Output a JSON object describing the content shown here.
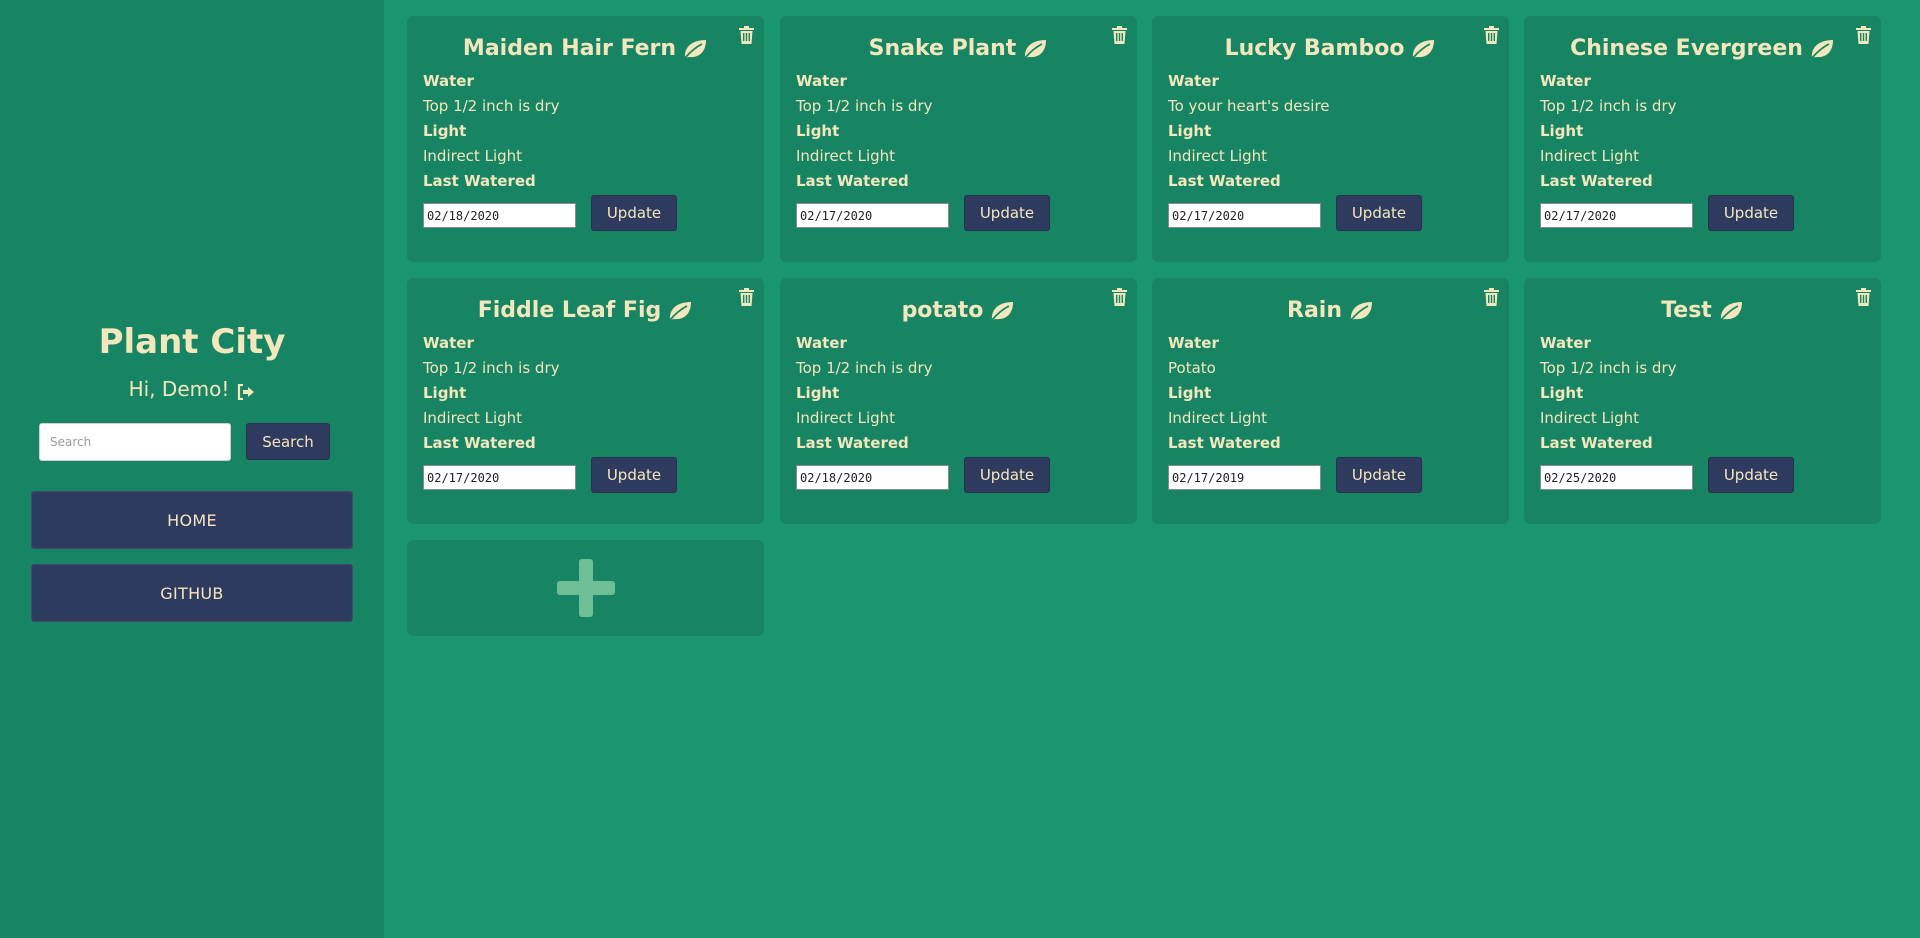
{
  "sidebar": {
    "title": "Plant City",
    "greeting": "Hi, Demo!",
    "logout_icon": "sign-out-icon",
    "search": {
      "placeholder": "Search",
      "value": "",
      "button_label": "Search"
    },
    "nav": [
      {
        "label": "HOME"
      },
      {
        "label": "GITHUB"
      }
    ]
  },
  "field_labels": {
    "water": "Water",
    "light": "Light",
    "last_watered": "Last Watered"
  },
  "update_label": "Update",
  "icons": {
    "title": "leaf-icon",
    "delete": "trash-icon",
    "add": "plus-icon"
  },
  "colors": {
    "background": "#1a966f",
    "sidebar": "#178563",
    "card": "#178563",
    "text": "#f3e7bd",
    "button": "#2e3a5e",
    "add_icon": "#6fbf96"
  },
  "plants": [
    {
      "name": "Maiden Hair Fern",
      "water": "Top 1/2 inch is dry",
      "light": "Indirect Light",
      "last_watered": "02/18/2020"
    },
    {
      "name": "Snake Plant",
      "water": "Top 1/2 inch is dry",
      "light": "Indirect Light",
      "last_watered": "02/17/2020"
    },
    {
      "name": "Lucky Bamboo",
      "water": "To your heart's desire",
      "light": "Indirect Light",
      "last_watered": "02/17/2020"
    },
    {
      "name": "Chinese Evergreen",
      "water": "Top 1/2 inch is dry",
      "light": "Indirect Light",
      "last_watered": "02/17/2020"
    },
    {
      "name": "Fiddle Leaf Fig",
      "water": "Top 1/2 inch is dry",
      "light": "Indirect Light",
      "last_watered": "02/17/2020"
    },
    {
      "name": "potato",
      "water": "Top 1/2 inch is dry",
      "light": "Indirect Light",
      "last_watered": "02/18/2020"
    },
    {
      "name": "Rain",
      "water": "Potato",
      "light": "Indirect Light",
      "last_watered": "02/17/2019"
    },
    {
      "name": "Test",
      "water": "Top 1/2 inch is dry",
      "light": "Indirect Light",
      "last_watered": "02/25/2020"
    }
  ]
}
